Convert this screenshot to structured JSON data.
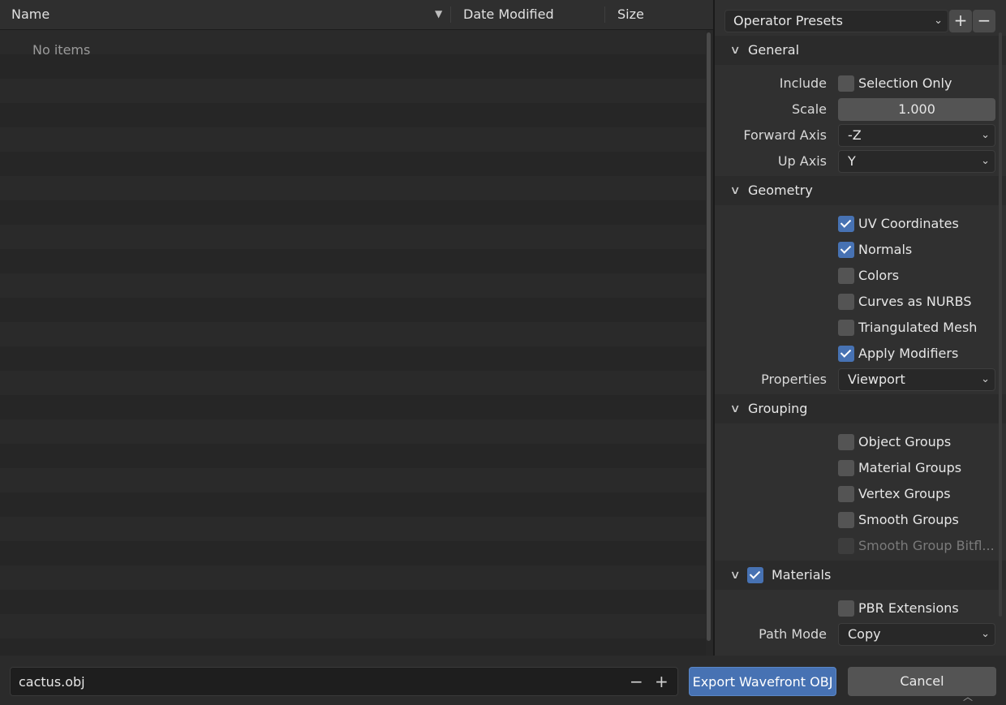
{
  "file_list": {
    "columns": [
      "Name",
      "Date Modified",
      "Size"
    ],
    "empty_text": "No items"
  },
  "panel": {
    "presets": {
      "label": "Operator Presets",
      "add": "+",
      "remove": "−"
    },
    "general": {
      "title": "General",
      "include_label": "Include",
      "selection_only": {
        "label": "Selection Only",
        "checked": false
      },
      "scale_label": "Scale",
      "scale_value": "1.000",
      "forward_axis_label": "Forward Axis",
      "forward_axis_value": "-Z",
      "up_axis_label": "Up Axis",
      "up_axis_value": "Y"
    },
    "geometry": {
      "title": "Geometry",
      "options": [
        {
          "label": "UV Coordinates",
          "checked": true
        },
        {
          "label": "Normals",
          "checked": true
        },
        {
          "label": "Colors",
          "checked": false
        },
        {
          "label": "Curves as NURBS",
          "checked": false
        },
        {
          "label": "Triangulated Mesh",
          "checked": false
        },
        {
          "label": "Apply Modifiers",
          "checked": true
        }
      ],
      "properties_label": "Properties",
      "properties_value": "Viewport"
    },
    "grouping": {
      "title": "Grouping",
      "options": [
        {
          "label": "Object Groups",
          "checked": false
        },
        {
          "label": "Material Groups",
          "checked": false
        },
        {
          "label": "Vertex Groups",
          "checked": false
        },
        {
          "label": "Smooth Groups",
          "checked": false
        },
        {
          "label": "Smooth Group Bitfl...",
          "checked": false,
          "disabled": true
        }
      ]
    },
    "materials": {
      "title": "Materials",
      "enabled": true,
      "pbr": {
        "label": "PBR Extensions",
        "checked": false
      },
      "path_mode_label": "Path Mode",
      "path_mode_value": "Copy"
    }
  },
  "bottom": {
    "filename": "cactus.obj",
    "export_label": "Export Wavefront OBJ",
    "cancel_label": "Cancel"
  },
  "colors": {
    "accent": "#4772b3",
    "background": "#2b2b2b"
  }
}
